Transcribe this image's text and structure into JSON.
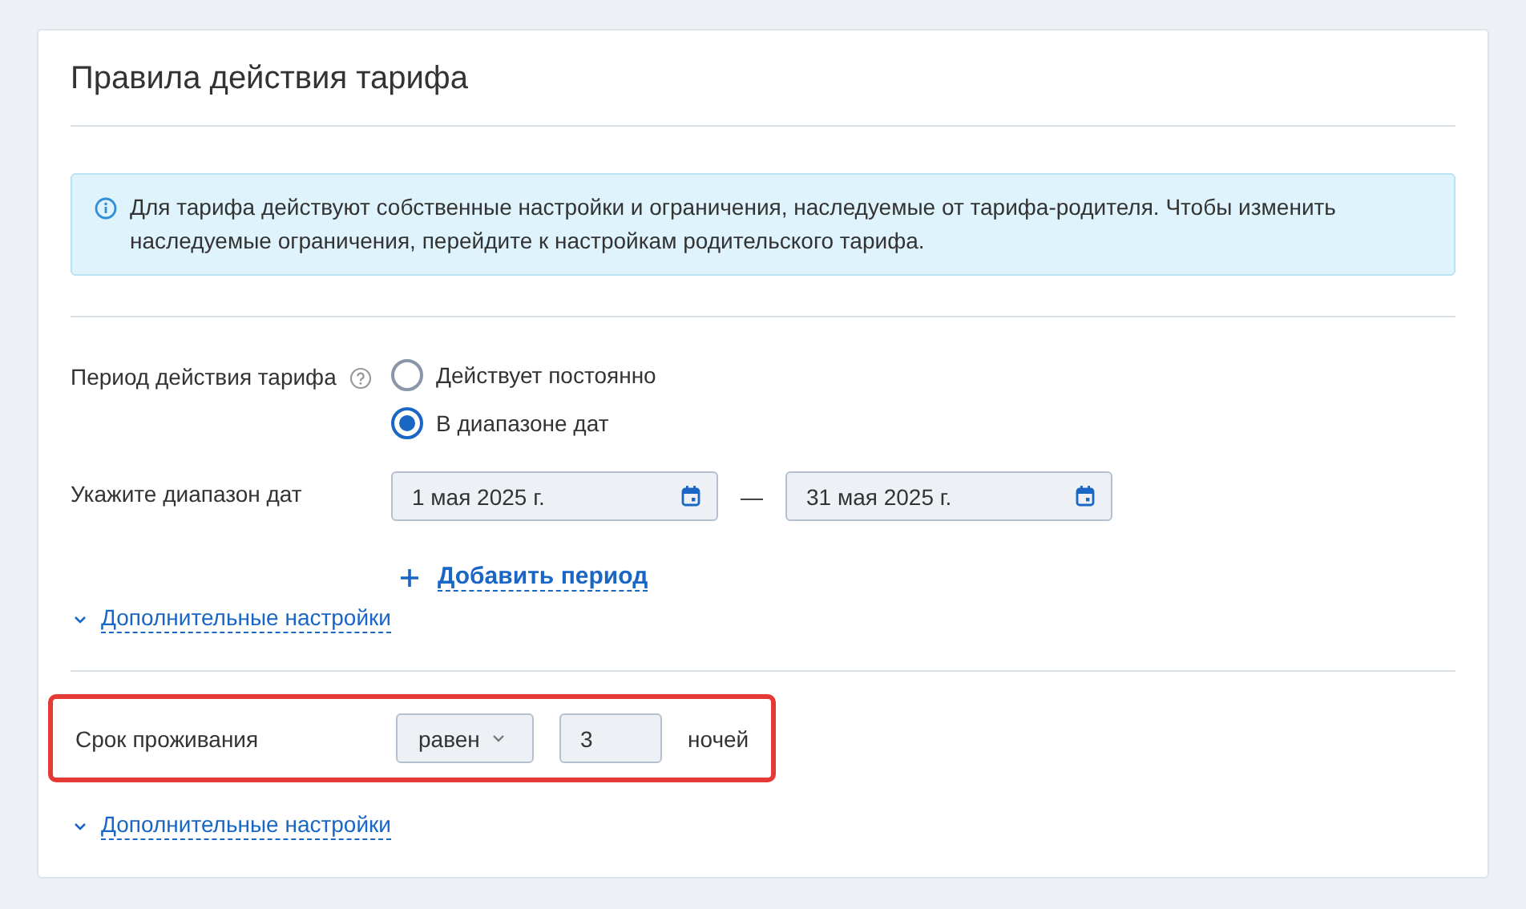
{
  "title": "Правила действия тарифа",
  "info": "Для тарифа действуют собственные настройки и ограничения, наследуемые от тарифа-родителя. Чтобы изменить наследуемые ограничения, перейдите к настройкам родительского тарифа.",
  "period": {
    "label": "Период действия тарифа",
    "options": [
      {
        "label": "Действует постоянно",
        "selected": false
      },
      {
        "label": "В диапазоне дат",
        "selected": true
      }
    ]
  },
  "date_range": {
    "label": "Укажите диапазон дат",
    "from": "1 мая 2025 г.",
    "separator": "—",
    "to": "31 мая 2025 г."
  },
  "add_period": "Добавить период",
  "advanced_1": "Дополнительные настройки",
  "stay": {
    "highlighted": true,
    "label": "Срок проживания",
    "operator": "равен",
    "value": "3",
    "unit": "ночей"
  },
  "advanced_2": "Дополнительные настройки"
}
